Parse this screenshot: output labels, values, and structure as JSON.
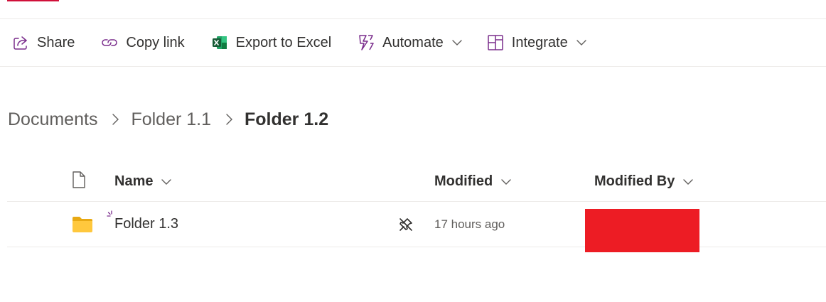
{
  "toolbar": {
    "share_label": "Share",
    "copy_link_label": "Copy link",
    "export_label": "Export to Excel",
    "automate_label": "Automate",
    "integrate_label": "Integrate"
  },
  "breadcrumb": {
    "items": [
      "Documents",
      "Folder 1.1"
    ],
    "current": "Folder 1.2"
  },
  "columns": {
    "name": "Name",
    "modified": "Modified",
    "modified_by": "Modified By"
  },
  "rows": [
    {
      "name": "Folder 1.3",
      "modified": "17 hours ago",
      "modified_by_redacted": true
    }
  ],
  "icons": {
    "share": "share-icon",
    "copy_link": "link-icon",
    "export": "excel-icon",
    "automate": "flow-icon",
    "integrate": "integrate-icon",
    "file_type": "document-icon",
    "folder": "folder-icon",
    "new_item": "new-indicator-icon",
    "sync_status": "pin-off-icon"
  },
  "colors": {
    "accent": "#7a2d8c",
    "excel_green": "#1d6f42",
    "folder_yellow": "#ffc83d",
    "redaction": "#ed1c24",
    "tab_indicator": "#d0103a"
  }
}
